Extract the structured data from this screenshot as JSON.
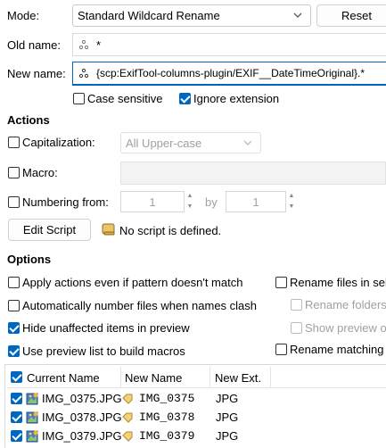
{
  "mode": {
    "label": "Mode:",
    "value": "Standard Wildcard Rename",
    "reset_label": "Reset"
  },
  "old_name": {
    "label": "Old name:",
    "value": "*"
  },
  "new_name": {
    "label": "New name:",
    "value": "{scp:ExifTool-columns-plugin/EXIF__DateTimeOriginal}.*"
  },
  "flags": {
    "case_sensitive": {
      "label": "Case sensitive",
      "checked": false
    },
    "ignore_extension": {
      "label": "Ignore extension",
      "checked": true
    }
  },
  "actions": {
    "title": "Actions",
    "capitalization": {
      "label": "Capitalization:",
      "value": "All Upper-case",
      "checked": false
    },
    "macro": {
      "label": "Macro:",
      "checked": false
    },
    "numbering": {
      "label": "Numbering from:",
      "from": "1",
      "by_label": "by",
      "by": "1",
      "checked": false
    },
    "edit_script_label": "Edit Script",
    "script_status": "No script is defined."
  },
  "options": {
    "title": "Options",
    "apply_even": {
      "label": "Apply actions even if pattern doesn't match",
      "checked": false
    },
    "auto_number": {
      "label": "Automatically number files when names clash",
      "checked": false
    },
    "hide_unaffected": {
      "label": "Hide unaffected items in preview",
      "checked": true
    },
    "use_preview": {
      "label": "Use preview list to build macros",
      "checked": true
    },
    "rename_files_in": {
      "label": "Rename files in sel",
      "checked": false
    },
    "rename_folders": {
      "label": "Rename folders",
      "checked": false
    },
    "show_preview": {
      "label": "Show preview o",
      "checked": false
    },
    "rename_matching": {
      "label": "Rename matching",
      "checked": false
    }
  },
  "table": {
    "headers": [
      "Current Name",
      "New Name",
      "New Ext."
    ],
    "rows": [
      {
        "current": "IMG_0375.JPG",
        "new": "IMG_0375",
        "ext": "JPG"
      },
      {
        "current": "IMG_0378.JPG",
        "new": "IMG_0378",
        "ext": "JPG"
      },
      {
        "current": "IMG_0379.JPG",
        "new": "IMG_0379",
        "ext": "JPG"
      }
    ]
  },
  "colors": {
    "accent": "#0067c0",
    "disabled_text": "#a0a0a0"
  },
  "icons": {
    "wildcard": "wildcard-icon",
    "script": "script-icon",
    "image_file": "image-file-icon",
    "rename_tag": "tag-icon"
  }
}
